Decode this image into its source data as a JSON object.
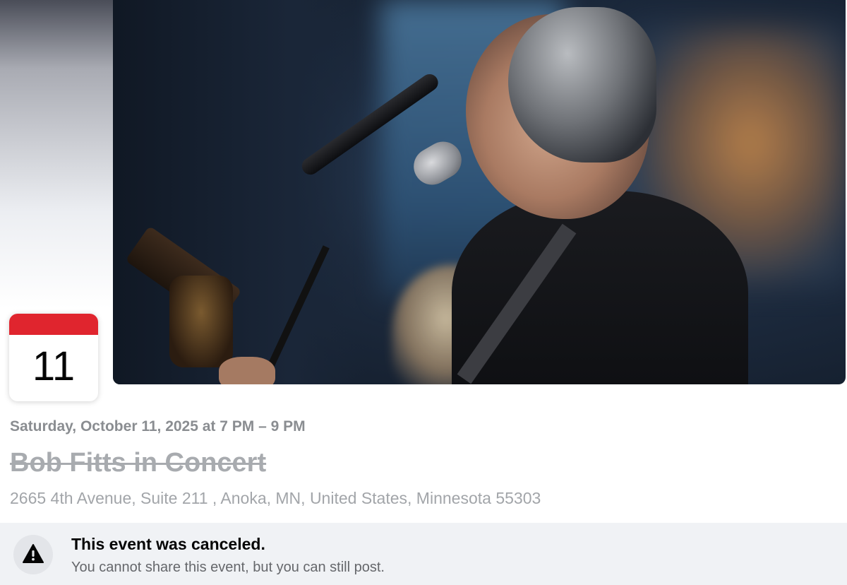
{
  "event": {
    "calendar_day": "11",
    "date_time": "Saturday, October 11, 2025 at 7 PM – 9 PM",
    "title": "Bob Fitts in Concert",
    "address": "2665 4th Avenue, Suite 211 , Anoka, MN, United States, Minnesota 55303",
    "cover_photo": "singer-with-microphone-photo"
  },
  "banner": {
    "icon": "warning-icon",
    "title": "This event was canceled.",
    "subtitle": "You cannot share this event, but you can still post."
  },
  "colors": {
    "calendar_accent": "#e0252e",
    "banner_bg": "#f0f2f5",
    "muted_text": "#8a8d91"
  }
}
